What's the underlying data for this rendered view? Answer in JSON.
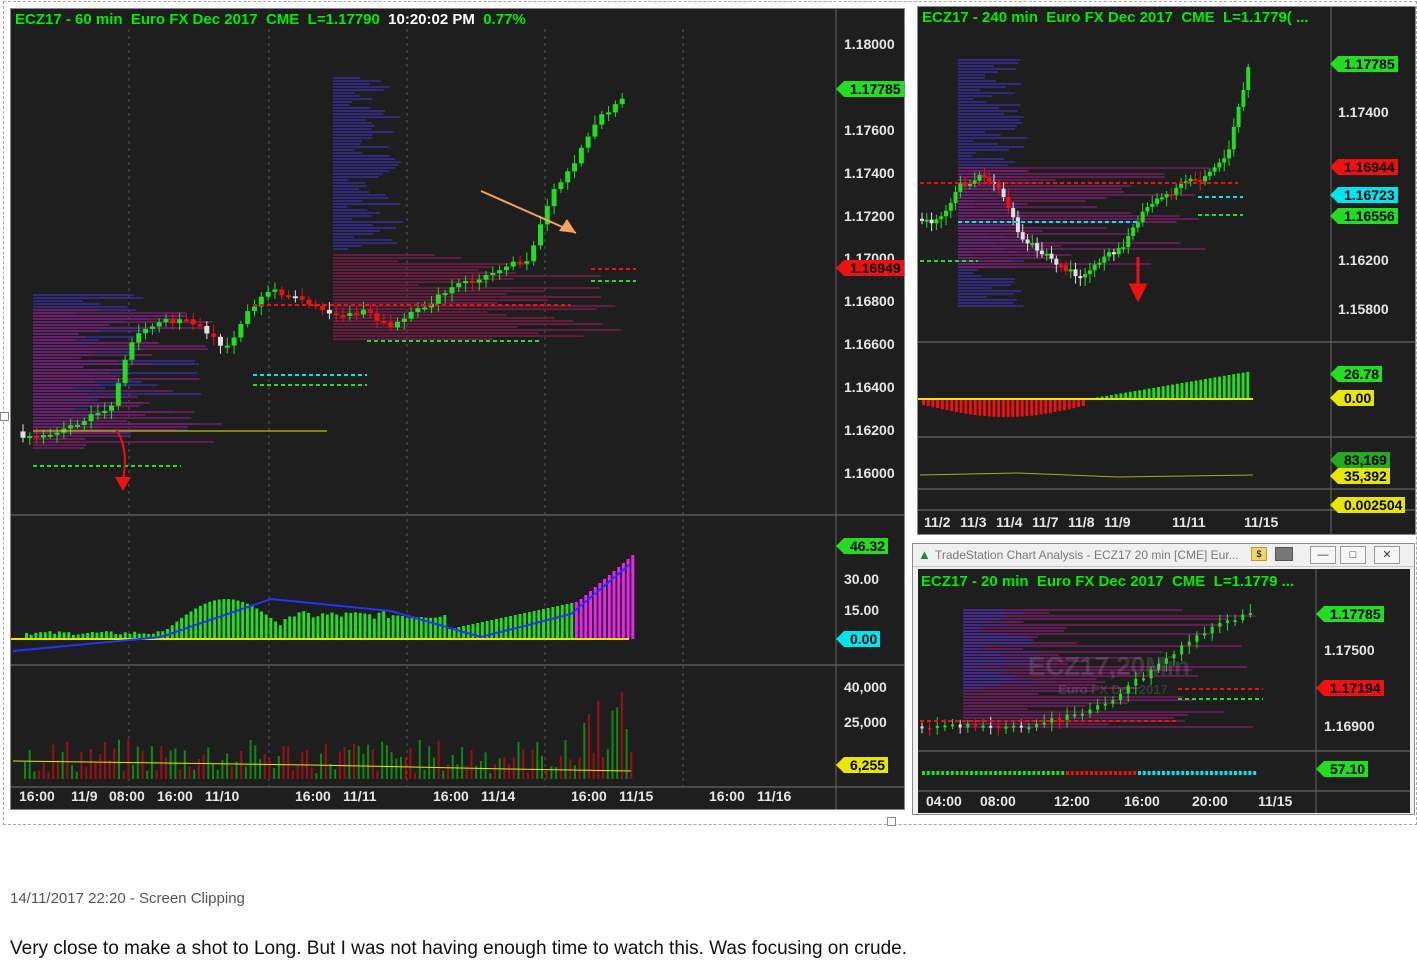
{
  "panels": {
    "main": {
      "symbol": "ECZ17 - 60 min",
      "desc": "Euro FX Dec 2017",
      "exchange": "CME",
      "last": "L=1.17790",
      "time": "10:20:02 PM",
      "change": "0.77%",
      "price_axis": [
        "1.18000",
        "1.17600",
        "1.17400",
        "1.17200",
        "1.17000",
        "1.16800",
        "1.16600",
        "1.16400",
        "1.16200",
        "1.16000"
      ],
      "price_tags": [
        {
          "label": "1.17785",
          "color": "#22dd22"
        },
        {
          "label": "1.16949",
          "color": "#ee1111"
        }
      ],
      "ind_axis": [
        "30.00",
        "15.00"
      ],
      "ind_tags": [
        {
          "label": "46.32",
          "color": "#22dd22"
        },
        {
          "label": "0.00",
          "color": "#00e5ee"
        }
      ],
      "vol_axis": [
        "40,000",
        "25,000"
      ],
      "vol_tag": {
        "label": "6,255",
        "color": "#e6e600"
      },
      "x_labels": [
        "16:00",
        "11/9",
        "08:00",
        "16:00",
        "11/10",
        "16:00",
        "11/11",
        "16:00",
        "11/14",
        "16:00",
        "11/15",
        "16:00",
        "11/16"
      ]
    },
    "h4": {
      "symbol": "ECZ17 - 240 min",
      "desc": "Euro FX Dec 2017",
      "exchange": "CME",
      "last": "L=1.1779( ...",
      "price_axis": [
        "1.17400",
        "1.16200",
        "1.15800"
      ],
      "price_tags": [
        {
          "label": "1.17785",
          "color": "#22dd22"
        },
        {
          "label": "1.16944",
          "color": "#ee1111"
        },
        {
          "label": "1.16723",
          "color": "#00e5ee"
        },
        {
          "label": "1.16556",
          "color": "#22dd22"
        }
      ],
      "ind_tags": [
        {
          "label": "26.78",
          "color": "#22dd22"
        },
        {
          "label": "0.00",
          "color": "#e6e600"
        }
      ],
      "vol_tags": [
        {
          "label": "83,169",
          "color": "#22aa22"
        },
        {
          "label": "35,392",
          "color": "#e6e600"
        },
        {
          "label": "0.002504",
          "color": "#e6e600"
        }
      ],
      "x_labels": [
        "11/2",
        "11/3",
        "11/4",
        "11/7",
        "11/8",
        "11/9",
        "11/11",
        "11/15"
      ]
    },
    "m20": {
      "window_title": "TradeStation Chart Analysis - ECZ17 20 min [CME] Eur...",
      "symbol": "ECZ17 - 20 min",
      "desc": "Euro FX Dec 2017",
      "exchange": "CME",
      "last": "L=1.1779 ...",
      "watermark": "ECZ17,20Min",
      "watermark_sub": "Euro FX Dec 2017",
      "price_axis": [
        "1.17500",
        "1.16900"
      ],
      "price_tags": [
        {
          "label": "1.17785",
          "color": "#22dd22"
        },
        {
          "label": "1.17194",
          "color": "#ee1111"
        }
      ],
      "ind_tag": {
        "label": "57.10",
        "color": "#22dd22"
      },
      "x_labels": [
        "04:00",
        "08:00",
        "12:00",
        "16:00",
        "20:00",
        "11/15"
      ]
    }
  },
  "colors": {
    "bg": "#1e1e1e",
    "up": "#22dd22",
    "down": "#ee1111",
    "neutral": "#e0e0e0",
    "profile": "#3a2d9e",
    "arrow": "#f4a460"
  },
  "clipping": "14/11/2017 22:20 - Screen Clipping",
  "note": "Very close to make a shot to Long. But I was not having enough time to watch this. Was focusing on crude."
}
